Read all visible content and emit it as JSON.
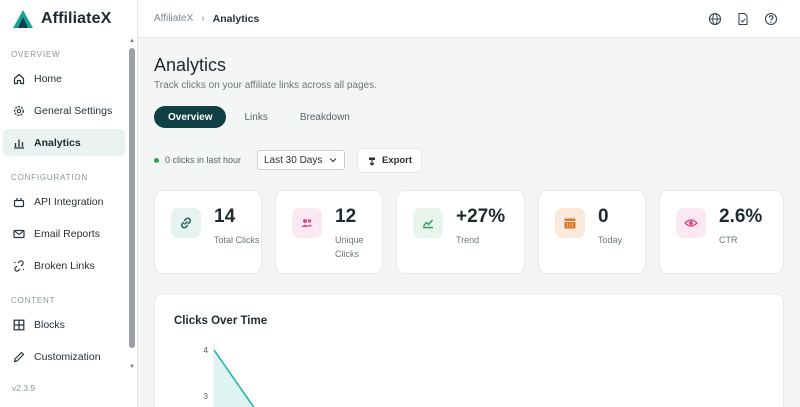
{
  "brand": {
    "name": "AffiliateX"
  },
  "sidebar": {
    "sections": [
      {
        "label": "OVERVIEW",
        "items": [
          {
            "label": "Home",
            "icon": "home-icon"
          },
          {
            "label": "General Settings",
            "icon": "gear-icon"
          },
          {
            "label": "Analytics",
            "icon": "bar-chart-icon",
            "active": true
          }
        ]
      },
      {
        "label": "CONFIGURATION",
        "items": [
          {
            "label": "API Integration",
            "icon": "plug-icon"
          },
          {
            "label": "Email Reports",
            "icon": "mail-icon"
          },
          {
            "label": "Broken Links",
            "icon": "broken-link-icon"
          }
        ]
      },
      {
        "label": "CONTENT",
        "items": [
          {
            "label": "Blocks",
            "icon": "grid-icon"
          },
          {
            "label": "Customization",
            "icon": "pencil-icon"
          }
        ]
      }
    ],
    "version": "v2.3.9"
  },
  "topbar": {
    "breadcrumb_root": "AffiliateX",
    "breadcrumb_sep": "›",
    "breadcrumb_current": "Analytics",
    "icons": [
      "globe-icon",
      "document-icon",
      "help-icon"
    ]
  },
  "page": {
    "title": "Analytics",
    "subtitle": "Track clicks on your affiliate links across all pages."
  },
  "tabs": [
    {
      "label": "Overview",
      "active": true
    },
    {
      "label": "Links"
    },
    {
      "label": "Breakdown"
    }
  ],
  "toolbar": {
    "status_text": "0 clicks in last hour",
    "range_value": "Last 30 Days",
    "export_label": "Export"
  },
  "stats": [
    {
      "value": "14",
      "label": "Total Clicks",
      "icon": "link-icon",
      "accent": "#1f7a6e",
      "bg": "#e6f3f1"
    },
    {
      "value": "12",
      "label": "Unique Clicks",
      "icon": "users-icon",
      "accent": "#d64f8a",
      "bg": "#fbe9f1"
    },
    {
      "value": "+27%",
      "label": "Trend",
      "icon": "trend-up-icon",
      "accent": "#2e9e5b",
      "bg": "#e8f5ec"
    },
    {
      "value": "0",
      "label": "Today",
      "icon": "calendar-icon",
      "accent": "#d9782b",
      "bg": "#fbeadb"
    },
    {
      "value": "2.6%",
      "label": "CTR",
      "icon": "eye-icon",
      "accent": "#d64f8a",
      "bg": "#fbe9f1"
    }
  ],
  "colors": {
    "primary": "#0f3e43",
    "chart_line": "#2bb3b5"
  },
  "chart_data": {
    "type": "line",
    "title": "Clicks Over Time",
    "y_ticks": [
      4,
      3
    ],
    "x": [
      0,
      1
    ],
    "series": [
      {
        "values": [
          4,
          3
        ]
      }
    ],
    "ylim": [
      0,
      4
    ],
    "grid": false
  }
}
